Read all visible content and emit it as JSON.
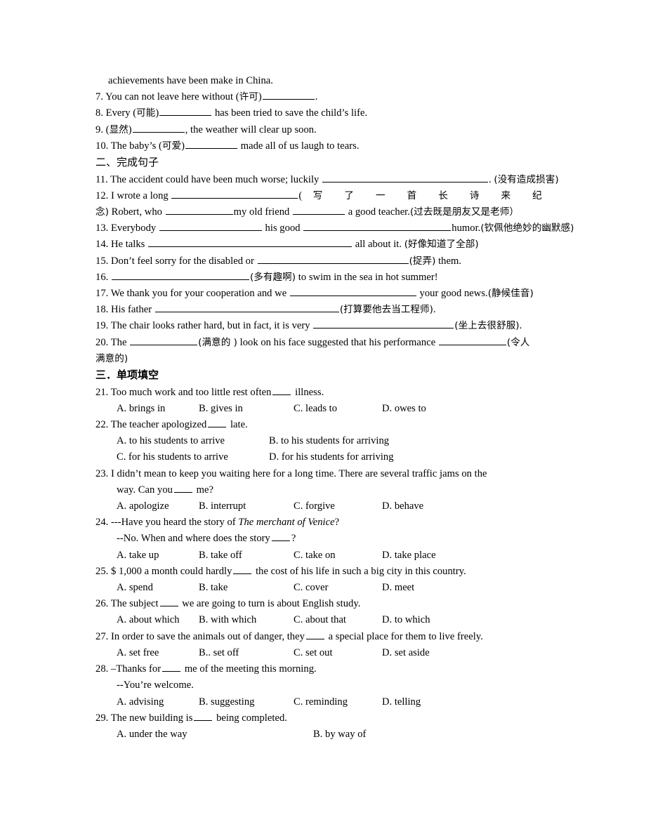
{
  "document": {
    "type": "english-exam-worksheet",
    "language": "zh-CN/en"
  },
  "carryover_line": "achievements have been make in China.",
  "section_one_tail": {
    "items": [
      {
        "number": "7.",
        "pre": "You can not leave here without (",
        "hint": "许可",
        "mid": ")",
        "post": "."
      },
      {
        "number": "8.",
        "pre": "Every (",
        "hint": "可能",
        "mid": ")",
        "post": "has been tried to save the child’s life."
      },
      {
        "number": "9.",
        "pre": "(",
        "hint": "显然",
        "mid": ")",
        "post": ", the weather will clear up soon."
      },
      {
        "number": "10.",
        "pre": "The baby’s (",
        "hint": "可爱",
        "mid": ")",
        "post": "made all of us laugh to tears."
      }
    ]
  },
  "section_two": {
    "heading": "二、完成句子",
    "items": [
      {
        "number": "11.",
        "text_before": "The accident could have been much worse; luckily",
        "text_after": ".",
        "hint": "(没有造成损害)"
      },
      {
        "number": "12.",
        "text_before": "I wrote a long",
        "open_paren": "(",
        "spaced_chars": [
          "写",
          "了",
          "一",
          "首",
          "长",
          "诗",
          "来",
          "纪"
        ],
        "wrap_prefix": "念) Robert, who",
        "wrap_mid": "my old friend",
        "wrap_after": "a good teacher.",
        "wrap_hint": "(过去既是朋友又是老师）"
      },
      {
        "number": "13.",
        "text_before": "Everybody",
        "text_mid": "his good",
        "text_after": "humor.",
        "hint": "(钦佩他绝妙的幽默感)"
      },
      {
        "number": "14.",
        "text_before": "He talks",
        "text_after": "all about it.",
        "hint": "(好像知道了全部)"
      },
      {
        "number": "15.",
        "text_before": "Don’t feel sorry for the disabled or",
        "hint": "(捉弄)",
        "text_after": "them."
      },
      {
        "number": "16.",
        "text_before": "",
        "hint": "(多有趣啊)",
        "text_after": "to swim in the sea in hot summer!"
      },
      {
        "number": "17.",
        "text_before": "We thank you for your cooperation and we",
        "text_after": "your good news.",
        "hint": "(静候佳音)"
      },
      {
        "number": "18.",
        "text_before": "His father",
        "hint": "(打算要他去当工程师)",
        "text_after": "."
      },
      {
        "number": "19.",
        "text_before": "The chair looks rather hard, but in fact, it is very",
        "hint": "(坐上去很舒服)",
        "text_after": "."
      },
      {
        "number": "20.",
        "text_before": "The",
        "hint1": "(满意的 )",
        "text_mid": "look on his face suggested that his performance",
        "hint2": "(令人",
        "wrap_tail": "满意的)"
      }
    ]
  },
  "section_three": {
    "heading": "三．单项填空",
    "questions": [
      {
        "number": "21.",
        "stem_before": "Too much work and too little rest often",
        "stem_after": "illness.",
        "layout": "four-col",
        "options": [
          "A. brings in",
          "B. gives in",
          "C. leads to",
          "D. owes to"
        ]
      },
      {
        "number": "22.",
        "stem_before": "The teacher apologized",
        "stem_after": "late.",
        "layout": "two-col",
        "options": [
          "A. to his students to arrive",
          "B. to his students for arriving",
          "C. for his students to arrive",
          "D. for his students for arriving"
        ]
      },
      {
        "number": "23.",
        "stem_line1": "I didn’t mean to keep you waiting here for a long time. There are several traffic jams on the",
        "stem_line2_before": "way. Can you",
        "stem_line2_after": "me?",
        "layout": "four-col",
        "options": [
          "A. apologize",
          "B. interrupt",
          "C. forgive",
          "D. behave"
        ]
      },
      {
        "number": "24.",
        "stem_line1_pre": "---Have you heard the story of ",
        "stem_line1_italic": "The merchant of Venice",
        "stem_line1_post": "?",
        "stem_line2_before": "--No. When and where does the story",
        "stem_line2_after": "?",
        "layout": "four-col",
        "options": [
          "A. take up",
          "B. take off",
          "C. take on",
          "D. take place"
        ]
      },
      {
        "number": "25.",
        "stem_before": "$ 1,000 a month could hardly",
        "stem_after": "the cost of his life in such a big city in this country.",
        "layout": "four-col",
        "options": [
          "A. spend",
          "B. take",
          "C. cover",
          "D. meet"
        ]
      },
      {
        "number": "26.",
        "stem_before": "The subject",
        "stem_after": "we are going to turn is about English study.",
        "layout": "four-col",
        "options": [
          "A. about which",
          "B. with which",
          "C. about that",
          "D. to which"
        ]
      },
      {
        "number": "27.",
        "stem_before": "In order to save the animals out of danger, they",
        "stem_after": "a special place for them to live freely.",
        "layout": "four-col",
        "options": [
          "A. set free",
          "B.. set off",
          "C. set out",
          "D. set aside"
        ]
      },
      {
        "number": "28.",
        "stem_line1_before": "–Thanks for",
        "stem_line1_after": "me of the meeting this morning.",
        "stem_line2": "--You’re welcome.",
        "layout": "four-col",
        "options": [
          "A. advising",
          "B. suggesting",
          "C. reminding",
          "D. telling"
        ]
      },
      {
        "number": "29.",
        "stem_before": "The new building is",
        "stem_after": "being completed.",
        "layout": "two-col-partial",
        "options": [
          "A. under the way",
          "B. by way of"
        ]
      }
    ]
  }
}
